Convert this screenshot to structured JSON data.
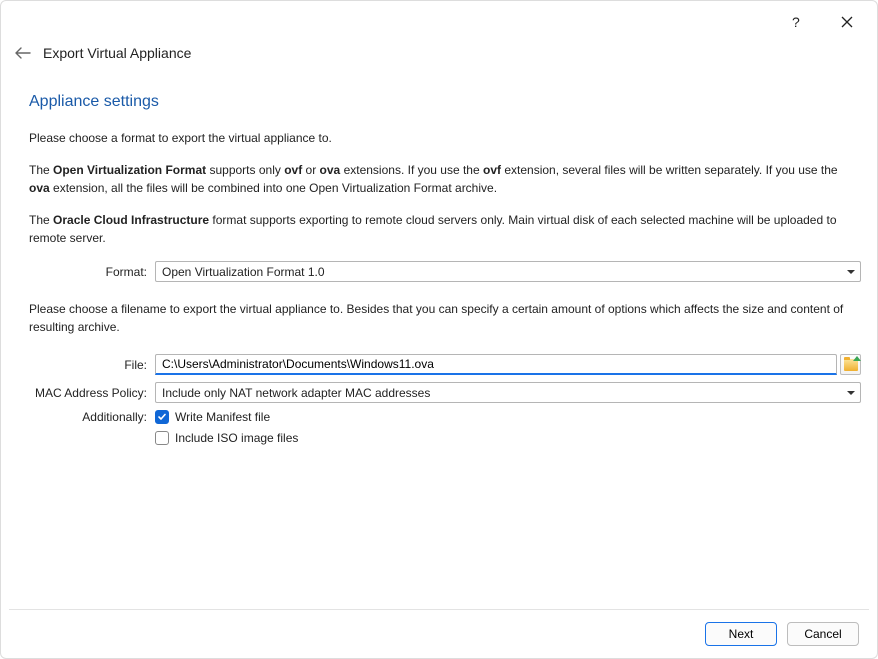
{
  "window": {
    "title": "Export Virtual Appliance"
  },
  "section": {
    "title": "Appliance settings",
    "p1": "Please choose a format to export the virtual appliance to.",
    "p2_a": "The ",
    "p2_b": "Open Virtualization Format",
    "p2_c": " supports only ",
    "p2_d": "ovf",
    "p2_e": " or ",
    "p2_f": "ova",
    "p2_g": " extensions. If you use the ",
    "p2_h": "ovf",
    "p2_i": " extension, several files will be written separately. If you use the ",
    "p2_j": "ova",
    "p2_k": " extension, all the files will be combined into one Open Virtualization Format archive.",
    "p3_a": "The ",
    "p3_b": "Oracle Cloud Infrastructure",
    "p3_c": " format supports exporting to remote cloud servers only. Main virtual disk of each selected machine will be uploaded to remote server.",
    "p4": "Please choose a filename to export the virtual appliance to. Besides that you can specify a certain amount of options which affects the size and content of resulting archive."
  },
  "form": {
    "format_label": "Format:",
    "format_value": "Open Virtualization Format 1.0",
    "file_label": "File:",
    "file_value": "C:\\Users\\Administrator\\Documents\\Windows11.ova",
    "mac_label": "MAC Address Policy:",
    "mac_value": "Include only NAT network adapter MAC addresses",
    "additionally_label": "Additionally:",
    "write_manifest": "Write Manifest file",
    "include_iso": "Include ISO image files"
  },
  "footer": {
    "next": "Next",
    "cancel": "Cancel"
  }
}
